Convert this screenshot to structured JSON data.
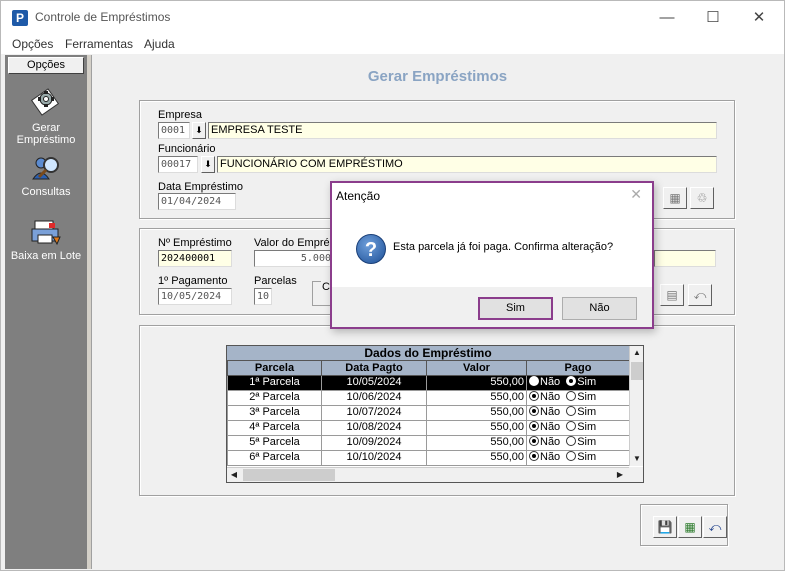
{
  "window": {
    "title": "Controle de Empréstimos",
    "app_icon": "P",
    "controls": {
      "minimize": "—",
      "maximize": "☐",
      "close": "✕"
    }
  },
  "menu": [
    "Opções",
    "Ferramentas",
    "Ajuda"
  ],
  "sidebar": {
    "header": "Opções",
    "items": [
      {
        "label": "Gerar Empréstimo",
        "icon": "gear-document-icon"
      },
      {
        "label": "Consultas",
        "icon": "magnifier-icon"
      },
      {
        "label": "Baixa em Lote",
        "icon": "printer-icon"
      }
    ]
  },
  "main": {
    "heading": "Gerar Empréstimos",
    "empresa": {
      "label": "Empresa",
      "code": "0001",
      "name": "EMPRESA TESTE"
    },
    "funcionario": {
      "label": "Funcionário",
      "code": "00017",
      "name": "FUNCIONÁRIO COM EMPRÉSTIMO"
    },
    "data_emprestimo": {
      "label": "Data Empréstimo",
      "value": "01/04/2024"
    },
    "num_emprestimo": {
      "label": "Nº Empréstimo",
      "value": "202400001"
    },
    "valor": {
      "label": "Valor do Emprés",
      "value": "5.000"
    },
    "primeiro_pagamento": {
      "label": "1º Pagamento",
      "value": "10/05/2024"
    },
    "parcelas": {
      "label": "Parcelas",
      "value": "10"
    },
    "ca_label": "C"
  },
  "grid": {
    "title": "Dados do Empréstimo",
    "columns": [
      "Parcela",
      "Data Pagto",
      "Valor",
      "Pago"
    ],
    "rows": [
      {
        "parcela": "1ª Parcela",
        "data": "10/05/2024",
        "valor": "550,00",
        "pago": "sim"
      },
      {
        "parcela": "2ª Parcela",
        "data": "10/06/2024",
        "valor": "550,00",
        "pago": "nao"
      },
      {
        "parcela": "3ª Parcela",
        "data": "10/07/2024",
        "valor": "550,00",
        "pago": "nao"
      },
      {
        "parcela": "4ª Parcela",
        "data": "10/08/2024",
        "valor": "550,00",
        "pago": "nao"
      },
      {
        "parcela": "5ª Parcela",
        "data": "10/09/2024",
        "valor": "550,00",
        "pago": "nao"
      },
      {
        "parcela": "6ª Parcela",
        "data": "10/10/2024",
        "valor": "550,00",
        "pago": "nao"
      }
    ],
    "radio_no": "Não",
    "radio_yes": "Sim"
  },
  "dialog": {
    "title": "Atenção",
    "message": "Esta parcela já foi paga. Confirma alteração?",
    "yes": "Sim",
    "no": "Não",
    "close": "✕",
    "icon_glyph": "?"
  },
  "colors": {
    "accent": "#8b3d8c",
    "heading": "#8aa4c3",
    "grid_header": "#a5b4c8",
    "highlight_field": "#ffffe6"
  }
}
